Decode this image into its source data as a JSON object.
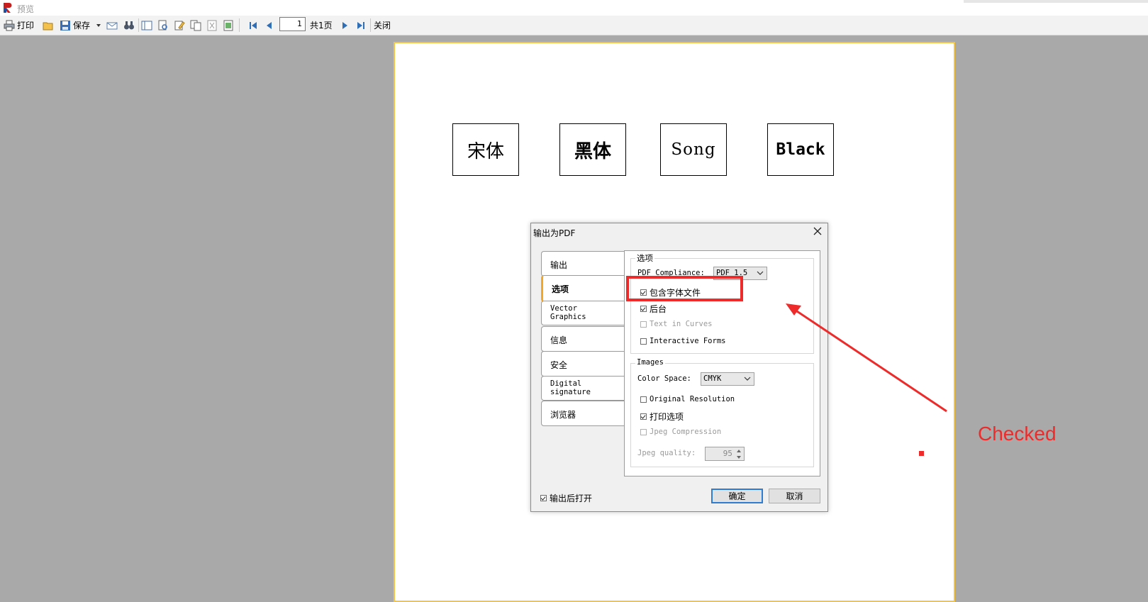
{
  "window": {
    "title": "预览"
  },
  "toolbar": {
    "print_label": "打印",
    "save_label": "保存",
    "page_number": "1",
    "page_total": "共1页",
    "close_label": "关闭"
  },
  "document": {
    "boxes": [
      "宋体",
      "黑体",
      "Song",
      "Black"
    ]
  },
  "dialog": {
    "title": "输出为PDF",
    "tabs": [
      "输出",
      "选项",
      "Vector\nGraphics",
      "信息",
      "安全",
      "Digital\nsignature",
      "浏览器"
    ],
    "active_tab": "选项",
    "options_group": {
      "title": "选项",
      "pdf_compliance_label": "PDF Compliance:",
      "pdf_compliance_value": "PDF 1.5",
      "embed_fonts": {
        "label": "包含字体文件",
        "checked": true
      },
      "background": {
        "label": "后台",
        "checked": true
      },
      "text_in_curves": {
        "label": "Text in Curves",
        "checked": false,
        "disabled": true
      },
      "interactive_forms": {
        "label": "Interactive Forms",
        "checked": false
      }
    },
    "images_group": {
      "title": "Images",
      "color_space_label": "Color Space:",
      "color_space_value": "CMYK",
      "original_resolution": {
        "label": "Original Resolution",
        "checked": false
      },
      "print_options": {
        "label": "打印选项",
        "checked": true
      },
      "jpeg_compression": {
        "label": "Jpeg Compression",
        "checked": false,
        "disabled": true
      },
      "jpeg_quality_label": "Jpeg quality:",
      "jpeg_quality_value": "95"
    },
    "open_after_export": {
      "label": "输出后打开",
      "checked": true
    },
    "ok_label": "确定",
    "cancel_label": "取消"
  },
  "annotation": {
    "note": "Checked",
    "color": "#ee2b2b"
  }
}
